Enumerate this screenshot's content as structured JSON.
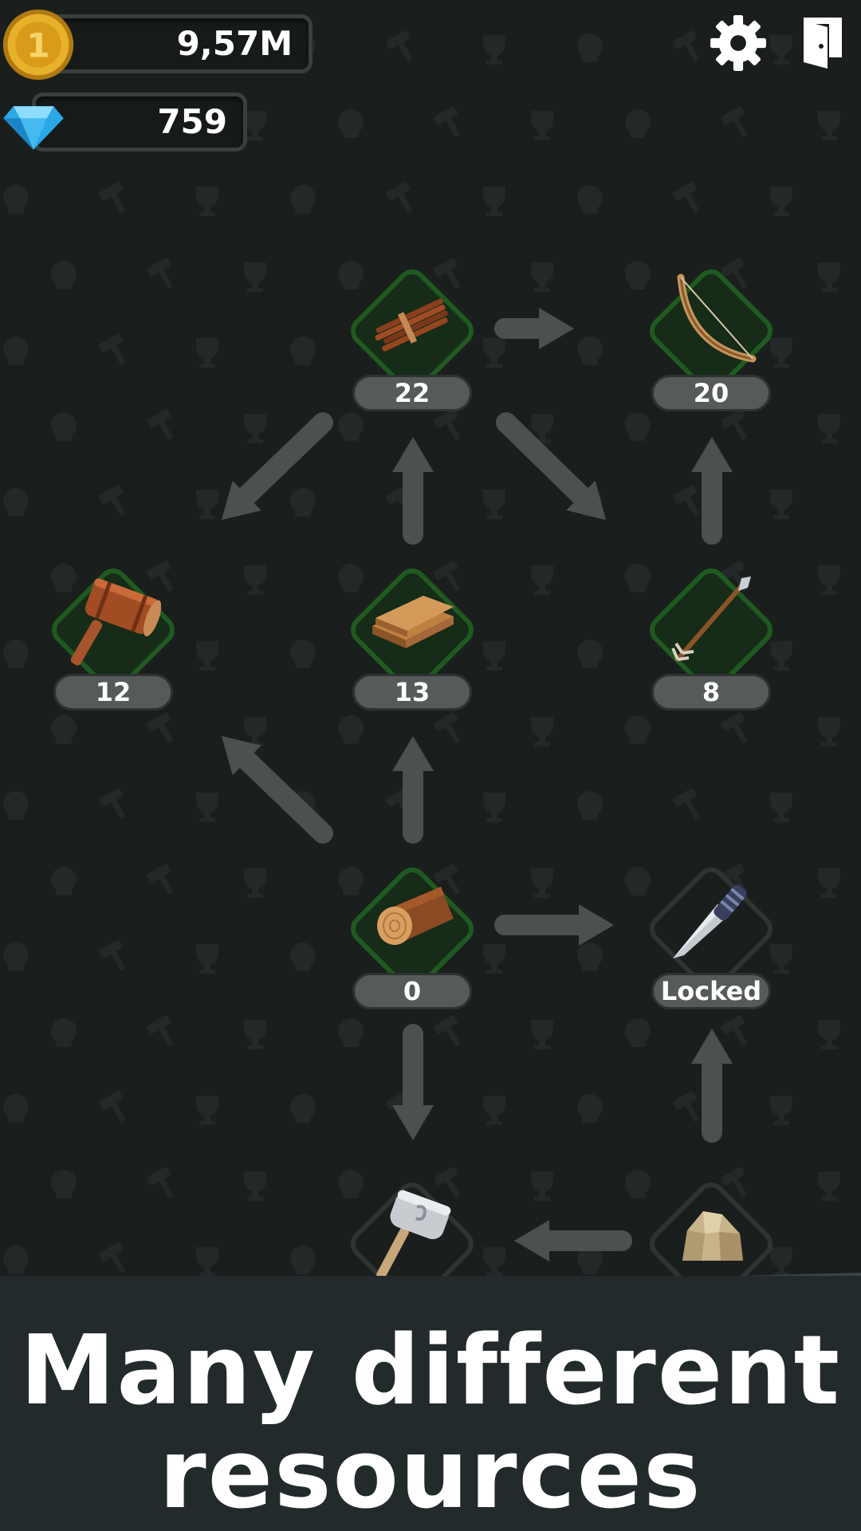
{
  "currencies": {
    "coins": {
      "value": "9,57M",
      "icon": "coin-icon",
      "symbol": "1"
    },
    "gems": {
      "value": "759",
      "icon": "gem-icon"
    }
  },
  "top_icons": [
    "gear-icon",
    "exit-door-icon"
  ],
  "nodes": {
    "sticks": {
      "label": "22",
      "icon": "sticks-icon",
      "state": "unlocked"
    },
    "bow": {
      "label": "20",
      "icon": "bow-icon",
      "state": "unlocked"
    },
    "mallet": {
      "label": "12",
      "icon": "mallet-icon",
      "state": "unlocked"
    },
    "planks": {
      "label": "13",
      "icon": "planks-icon",
      "state": "unlocked"
    },
    "arrow": {
      "label": "8",
      "icon": "arrow-icon",
      "state": "unlocked"
    },
    "log": {
      "label": "0",
      "icon": "log-icon",
      "state": "unlocked"
    },
    "knife": {
      "label": "Locked",
      "icon": "knife-icon",
      "state": "locked"
    },
    "stone_hammer": {
      "icon": "stone-hammer-icon",
      "state": "locked"
    },
    "stone": {
      "icon": "stone-icon",
      "state": "locked"
    }
  },
  "banner": {
    "line1": "Many different",
    "line2": "resources"
  },
  "colors": {
    "background": "#1a1e1d",
    "unlocked_border": "#1f5a20",
    "locked_border": "#2f3433",
    "arrow": "#4b5050",
    "banner": "#222a2c"
  }
}
